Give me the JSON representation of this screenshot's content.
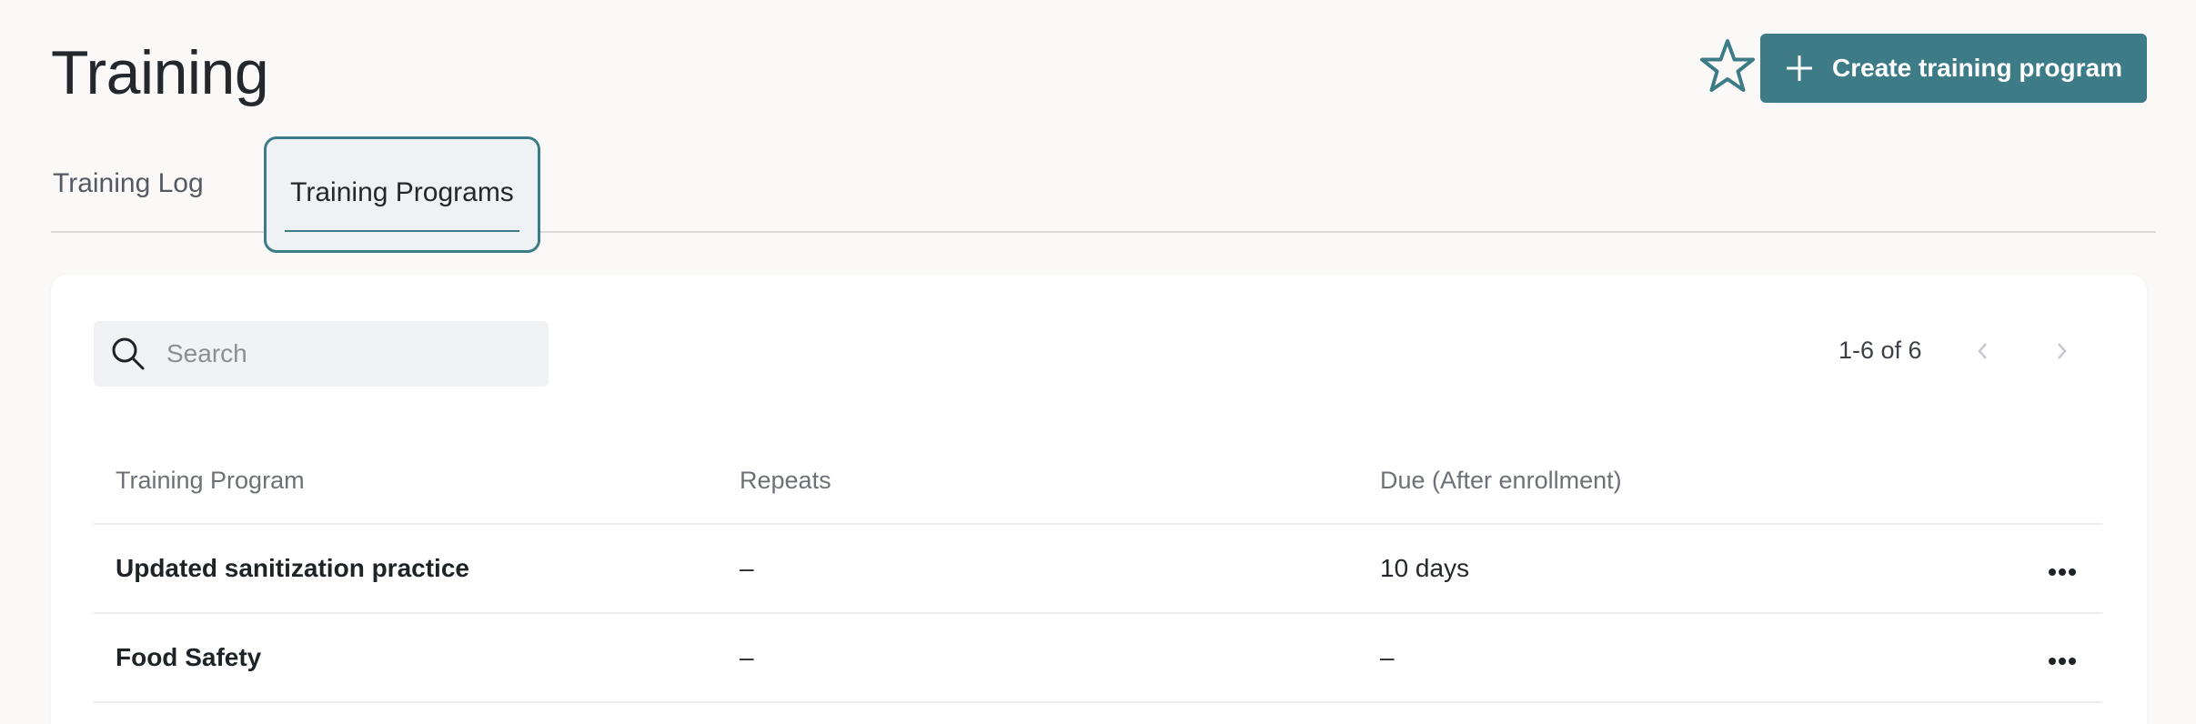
{
  "header": {
    "title": "Training",
    "create_button_label": "Create training program"
  },
  "icons": {
    "favorite": "star-icon",
    "create": "plus-icon",
    "search": "search-icon",
    "prev": "chevron-left-icon",
    "next": "chevron-right-icon",
    "row_actions": "more-horizontal-icon"
  },
  "colors": {
    "accent": "#3d7c87",
    "page_bg": "#faf9f8"
  },
  "tabs": [
    {
      "label": "Training Log",
      "selected": false
    },
    {
      "label": "Training Programs",
      "selected": true
    }
  ],
  "search": {
    "placeholder": "Search",
    "value": ""
  },
  "pagination": {
    "text": "1-6 of 6"
  },
  "table": {
    "columns": [
      "Training Program",
      "Repeats",
      "Due (After enrollment)"
    ],
    "rows": [
      {
        "program": "Updated sanitization practice",
        "repeats": "–",
        "due": "10 days"
      },
      {
        "program": "Food Safety",
        "repeats": "–",
        "due": "–"
      }
    ]
  }
}
